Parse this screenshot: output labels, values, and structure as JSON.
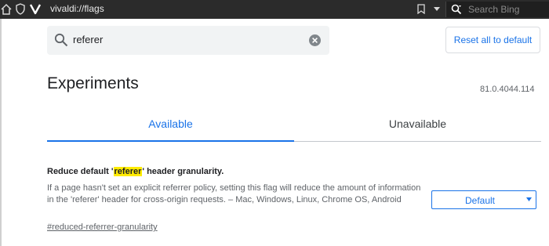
{
  "browser": {
    "url": "vivaldi://flags",
    "search_placeholder": "Search Bing"
  },
  "search": {
    "query": "referer"
  },
  "header": {
    "reset_label": "Reset all to default",
    "title": "Experiments",
    "version": "81.0.4044.114"
  },
  "tabs": [
    {
      "label": "Available",
      "active": true
    },
    {
      "label": "Unavailable",
      "active": false
    }
  ],
  "flag": {
    "title_prefix": "Reduce default '",
    "title_highlight": "referer",
    "title_suffix": "' header granularity.",
    "description": "If a page hasn't set an explicit referrer policy, setting this flag will reduce the amount of information in the 'referer' header for cross-origin requests. – Mac, Windows, Linux, Chrome OS, Android",
    "link": "#reduced-referrer-granularity",
    "selected_option": "Default"
  },
  "colors": {
    "accent": "#1a73e8",
    "highlight": "#ffeb00",
    "topbar": "#2b2b2b"
  }
}
